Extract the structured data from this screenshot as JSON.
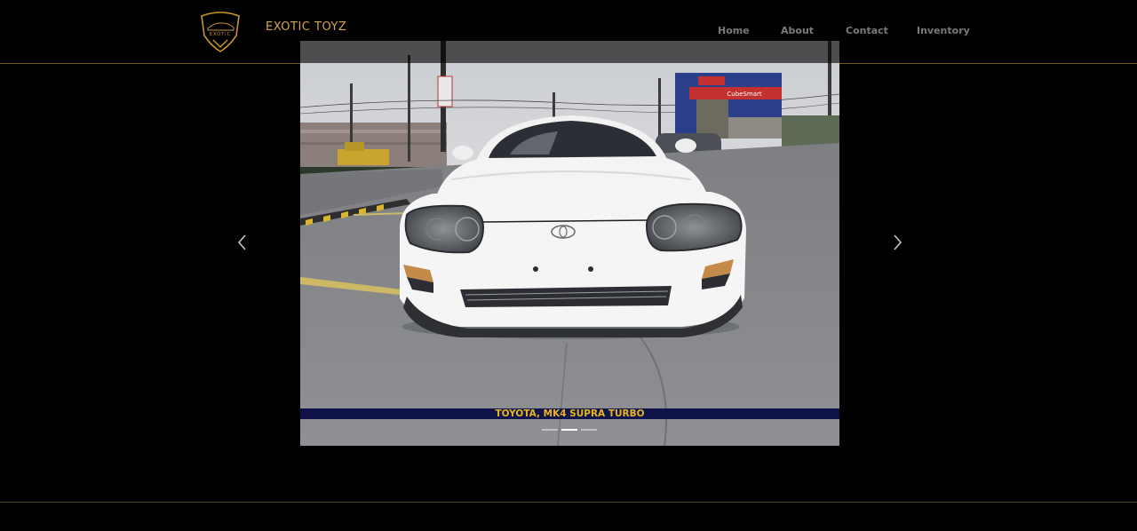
{
  "brand": {
    "logo_text": "EXOTIC",
    "name": "EXOTIC TOYZ"
  },
  "nav": {
    "items": [
      "Home",
      "About",
      "Contact",
      "Inventory"
    ]
  },
  "slider": {
    "caption": "TOYOTA, MK4 SUPRA TURBO",
    "active_slide": 2,
    "slide_count": 3,
    "image_subject": "white-toyota-supra-front-view",
    "prev_icon": "chevron-left-icon",
    "next_icon": "chevron-right-icon"
  },
  "colors": {
    "accent_gold": "#d4a64a",
    "caption_text": "#e8b520",
    "caption_bar": "#10124a",
    "nav_text": "#7a7a7a"
  }
}
